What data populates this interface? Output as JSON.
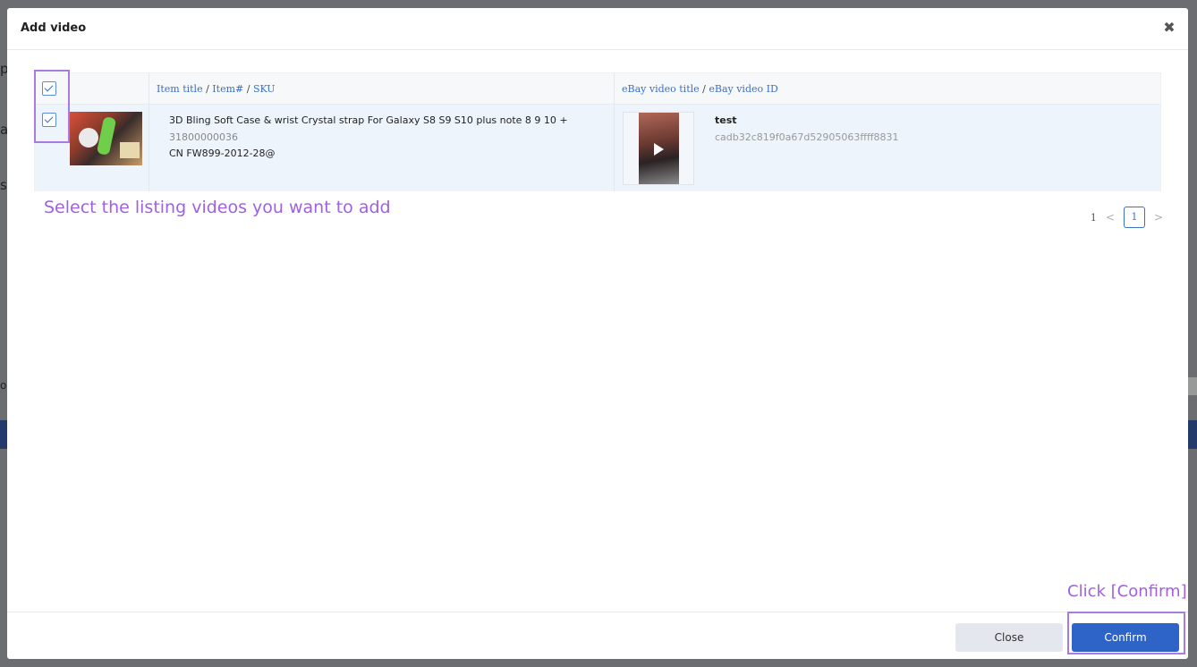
{
  "modal": {
    "title": "Add video",
    "close_icon": "close-icon"
  },
  "table": {
    "headers": {
      "item_title": "Item title",
      "item_num": "Item#",
      "sku": "SKU",
      "video_title": "eBay video title",
      "video_id": "eBay video ID",
      "separator": " / "
    },
    "rows": [
      {
        "checked": true,
        "item_title": "3D Bling Soft Case & wrist Crystal strap For Galaxy S8 S9 S10 plus note 8 9 10 +",
        "item_number": "31800000036",
        "sku": "CN FW899-2012-28@",
        "video_title": "test",
        "video_id": "cadb32c819f0a67d52905063ffff8831"
      }
    ]
  },
  "annotations": {
    "select_hint": "Select the listing videos you want to add",
    "confirm_hint": "Click [Confirm]"
  },
  "pagination": {
    "total": "1",
    "prev": "<",
    "current": "1",
    "next": ">"
  },
  "footer": {
    "close_label": "Close",
    "confirm_label": "Confirm"
  },
  "backdrop": {
    "letters": [
      "p",
      "a",
      "s",
      "ou"
    ]
  },
  "colors": {
    "accent": "#2e63c8",
    "annotation": "#a77be0",
    "row_highlight": "#eef4fc"
  }
}
